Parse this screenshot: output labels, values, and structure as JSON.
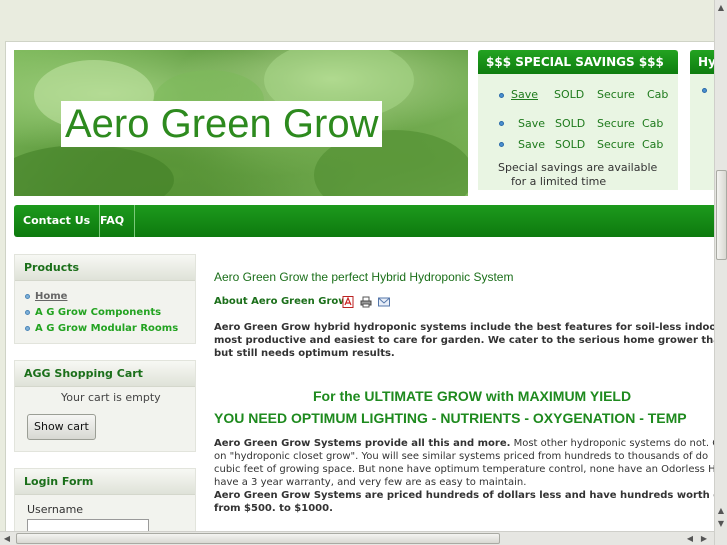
{
  "header": {
    "site_title": "Aero Green Grow"
  },
  "special_savings": {
    "title": "$$$ SPECIAL SAVINGS $$$",
    "rows": [
      [
        "Save",
        "SOLD",
        "Secure",
        "Cab"
      ],
      [
        "Save",
        "SOLD",
        "Secure",
        "Cab"
      ],
      [
        "Save",
        "SOLD",
        "Secure",
        "Cab"
      ]
    ],
    "note_line1": "Special savings are available",
    "note_line2": "for a limited time"
  },
  "side_module_right": {
    "title": "Hyd"
  },
  "nav": {
    "items": [
      "Contact Us",
      "FAQ"
    ]
  },
  "products": {
    "title": "Products",
    "items": [
      "Home",
      "A G Grow Components",
      "A G Grow Modular Rooms"
    ]
  },
  "cart": {
    "title": "AGG Shopping Cart",
    "status": "Your cart is empty",
    "button": "Show cart"
  },
  "login": {
    "title": "Login Form",
    "username_label": "Username"
  },
  "main": {
    "intro_title": "Aero Green Grow the perfect Hybrid Hydroponic System",
    "about": "About Aero Green Grow",
    "para1_line1": "Aero Green Grow hybrid hydroponic systems include the best features for soil-less indoor garde",
    "para1_line2": "most productive and easiest to care for garden. We cater to the serious home grower that can't d",
    "para1_line3": "but still needs optimum results.",
    "headline1": "For the ULTIMATE GROW with  MAXIMUM YIELD",
    "headline2": "YOU NEED OPTIMUM  LIGHTING - NUTRIENTS - OXYGENATION -  TEMP",
    "para2_bold": "Aero Green Grow Systems provide all this and more.",
    "para2_line1_rest": "  Most other hydroponic systems do not.  Co",
    "para2_line2": "on \"hydroponic closet grow\". You will see similar systems priced from hundreds to thousands of do",
    "para2_line3": "cubic feet of growing space.  But none have optimum temperature control, none have an Odorless He",
    "para2_line4": "have a 3 year warranty, and very few are as easy to maintain.",
    "para3_line1": "Aero Green Grow Systems are priced hundreds of dollars less and have hundreds worth of ac",
    "para3_line2": "from $500. to $1000."
  },
  "colors": {
    "brand_green": "#1e8a1e",
    "nav_green": "#0d7a0e",
    "link_green": "#23a321"
  }
}
